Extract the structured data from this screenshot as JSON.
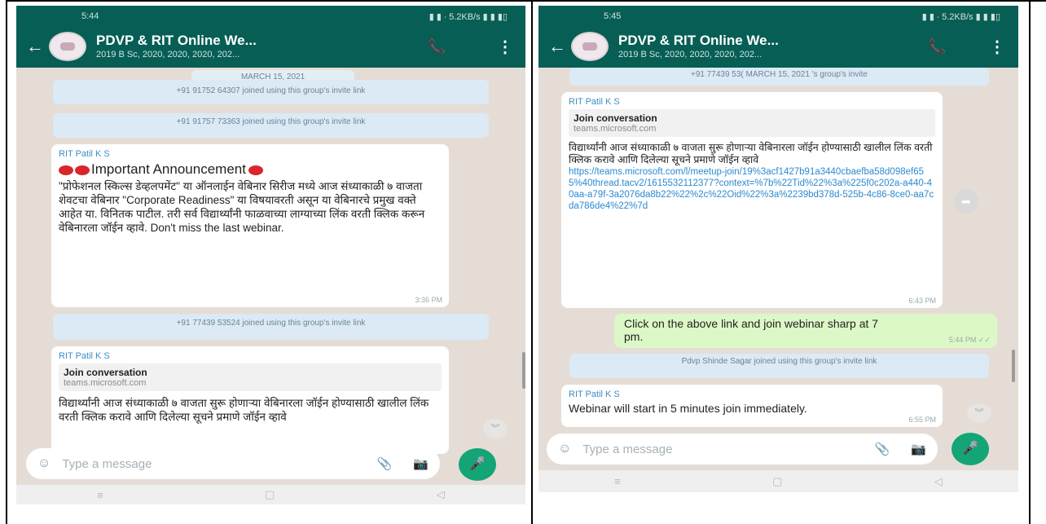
{
  "left": {
    "status": {
      "time": "5:44",
      "right": "▮ ▮ ∙ 5.2KB/s ▮ ▮ ▮▯"
    },
    "header": {
      "title": "PDVP & RIT Online We...",
      "subtitle": "2019 B Sc, 2020, 2020, 2020, 202..."
    },
    "date": "MARCH 15, 2021",
    "sys1": "+91 91752 64307 joined using this group's invite link",
    "sys2": "+91 91757 73363 joined using this group's invite link",
    "msg1": {
      "sender": "RIT Patil K S",
      "lead": "Important Announcement",
      "body": "\"प्रोफेशनल स्किल्स डेव्हलपमेंट\" या ऑनलाईन वेबिनार सिरीज मध्ये आज संध्याकाळी ७ वाजता शेवटचा वेबिनार \"Corporate Readiness\" या विषयावरती असून या वेबिनारचे प्रमुख वक्ते आहेत या. विनितक पाटील. तरी सर्व विद्यार्थ्यांनी फाळवाच्या लाग्याच्या लिंक वरती क्लिक करून वेबिनारला जॉईन व्हावे. Don't miss the last webinar.",
      "time": "3:36 PM"
    },
    "sys3": "+91 77439 53524 joined using this group's invite link",
    "msg2": {
      "sender": "RIT Patil K S",
      "preview_title": "Join conversation",
      "preview_host": "teams.microsoft.com",
      "body": "विद्यार्थ्यांनी आज संध्याकाळी ७ वाजता सुरू होणाऱ्या वेबिनारला जॉईन होण्यासाठी खालील लिंक वरती क्लिक करावे आणि दिलेल्या सूचने प्रमाणे जॉईन व्हावे"
    },
    "input": {
      "placeholder": "Type a message"
    }
  },
  "right": {
    "status": {
      "time": "5:45",
      "right": "▮ ▮ ∙ 5.2KB/s ▮ ▮ ▮▯"
    },
    "header": {
      "title": "PDVP & RIT Online We...",
      "subtitle": "2019 B Sc, 2020, 2020, 2020, 202..."
    },
    "sys_top": "+91 77439 53( MARCH 15, 2021 's group's invite",
    "msg1": {
      "sender": "RIT Patil K S",
      "preview_title": "Join conversation",
      "preview_host": "teams.microsoft.com",
      "body": "विद्यार्थ्यांनी आज संध्याकाळी ७ वाजता सुरू होणाऱ्या वेबिनारला जॉईन होण्यासाठी खालील लिंक वरती क्लिक करावे आणि दिलेल्या सूचने प्रमाणे जॉईन व्हावे",
      "link": "https://teams.microsoft.com/l/meetup-join/19%3acf1427b91a3440cbaefba58d098ef655%40thread.tacv2/1615532112377?context=%7b%22Tid%22%3a%225f0c202a-a440-40aa-a79f-3a2076da8b22%22%2c%22Oid%22%3a%2239bd378d-525b-4c86-8ce0-aa7cda786de4%22%7d",
      "time": "6:43 PM"
    },
    "msg2": {
      "body": "Click on the above link and join webinar sharp at 7 pm.",
      "time": "5:44 PM ✓✓"
    },
    "sys2": "Pdvp Shinde Sagar joined using this group's invite link",
    "msg3": {
      "sender": "RIT Patil K S",
      "body": "Webinar will start in 5 minutes join immediately.",
      "time": "6:55 PM"
    },
    "input": {
      "placeholder": "Type a message"
    }
  },
  "icons": {
    "back": "←",
    "call": "📞",
    "menu": "⋮",
    "emoji": "☺",
    "attach": "📎",
    "camera": "📷",
    "mic": "🎤",
    "nav_recent": "≡",
    "nav_home": "▢",
    "nav_back": "◁",
    "chevron_down": "︾",
    "forward": "➦"
  },
  "colors": {
    "header": "#075e54",
    "chat_bg": "#e5ddd5",
    "outgoing": "#dcf8c6",
    "accent": "#14a577"
  }
}
